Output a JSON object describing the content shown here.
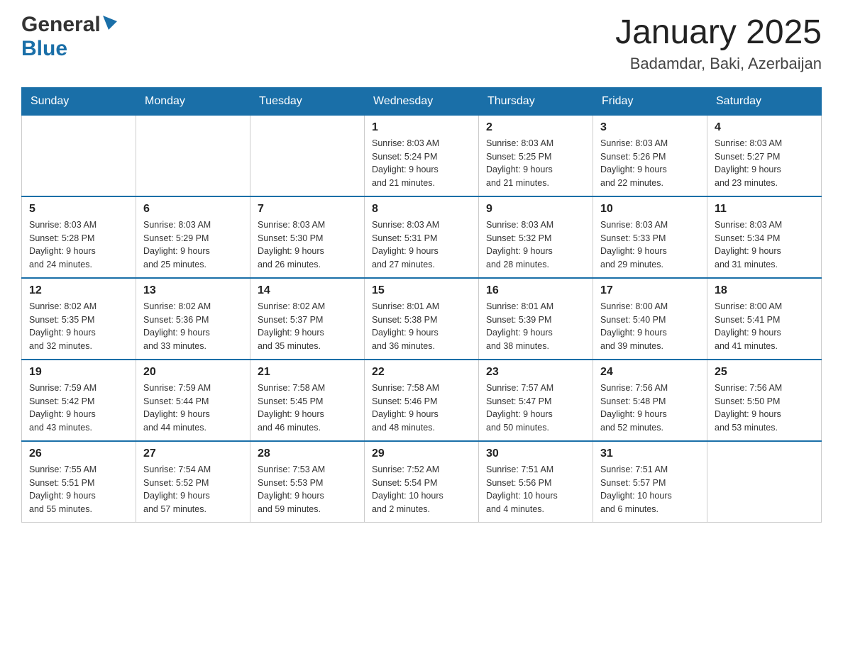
{
  "header": {
    "logo_general": "General",
    "logo_blue": "Blue",
    "month": "January 2025",
    "location": "Badamdar, Baki, Azerbaijan"
  },
  "days_of_week": [
    "Sunday",
    "Monday",
    "Tuesday",
    "Wednesday",
    "Thursday",
    "Friday",
    "Saturday"
  ],
  "weeks": [
    [
      {
        "day": "",
        "info": ""
      },
      {
        "day": "",
        "info": ""
      },
      {
        "day": "",
        "info": ""
      },
      {
        "day": "1",
        "info": "Sunrise: 8:03 AM\nSunset: 5:24 PM\nDaylight: 9 hours\nand 21 minutes."
      },
      {
        "day": "2",
        "info": "Sunrise: 8:03 AM\nSunset: 5:25 PM\nDaylight: 9 hours\nand 21 minutes."
      },
      {
        "day": "3",
        "info": "Sunrise: 8:03 AM\nSunset: 5:26 PM\nDaylight: 9 hours\nand 22 minutes."
      },
      {
        "day": "4",
        "info": "Sunrise: 8:03 AM\nSunset: 5:27 PM\nDaylight: 9 hours\nand 23 minutes."
      }
    ],
    [
      {
        "day": "5",
        "info": "Sunrise: 8:03 AM\nSunset: 5:28 PM\nDaylight: 9 hours\nand 24 minutes."
      },
      {
        "day": "6",
        "info": "Sunrise: 8:03 AM\nSunset: 5:29 PM\nDaylight: 9 hours\nand 25 minutes."
      },
      {
        "day": "7",
        "info": "Sunrise: 8:03 AM\nSunset: 5:30 PM\nDaylight: 9 hours\nand 26 minutes."
      },
      {
        "day": "8",
        "info": "Sunrise: 8:03 AM\nSunset: 5:31 PM\nDaylight: 9 hours\nand 27 minutes."
      },
      {
        "day": "9",
        "info": "Sunrise: 8:03 AM\nSunset: 5:32 PM\nDaylight: 9 hours\nand 28 minutes."
      },
      {
        "day": "10",
        "info": "Sunrise: 8:03 AM\nSunset: 5:33 PM\nDaylight: 9 hours\nand 29 minutes."
      },
      {
        "day": "11",
        "info": "Sunrise: 8:03 AM\nSunset: 5:34 PM\nDaylight: 9 hours\nand 31 minutes."
      }
    ],
    [
      {
        "day": "12",
        "info": "Sunrise: 8:02 AM\nSunset: 5:35 PM\nDaylight: 9 hours\nand 32 minutes."
      },
      {
        "day": "13",
        "info": "Sunrise: 8:02 AM\nSunset: 5:36 PM\nDaylight: 9 hours\nand 33 minutes."
      },
      {
        "day": "14",
        "info": "Sunrise: 8:02 AM\nSunset: 5:37 PM\nDaylight: 9 hours\nand 35 minutes."
      },
      {
        "day": "15",
        "info": "Sunrise: 8:01 AM\nSunset: 5:38 PM\nDaylight: 9 hours\nand 36 minutes."
      },
      {
        "day": "16",
        "info": "Sunrise: 8:01 AM\nSunset: 5:39 PM\nDaylight: 9 hours\nand 38 minutes."
      },
      {
        "day": "17",
        "info": "Sunrise: 8:00 AM\nSunset: 5:40 PM\nDaylight: 9 hours\nand 39 minutes."
      },
      {
        "day": "18",
        "info": "Sunrise: 8:00 AM\nSunset: 5:41 PM\nDaylight: 9 hours\nand 41 minutes."
      }
    ],
    [
      {
        "day": "19",
        "info": "Sunrise: 7:59 AM\nSunset: 5:42 PM\nDaylight: 9 hours\nand 43 minutes."
      },
      {
        "day": "20",
        "info": "Sunrise: 7:59 AM\nSunset: 5:44 PM\nDaylight: 9 hours\nand 44 minutes."
      },
      {
        "day": "21",
        "info": "Sunrise: 7:58 AM\nSunset: 5:45 PM\nDaylight: 9 hours\nand 46 minutes."
      },
      {
        "day": "22",
        "info": "Sunrise: 7:58 AM\nSunset: 5:46 PM\nDaylight: 9 hours\nand 48 minutes."
      },
      {
        "day": "23",
        "info": "Sunrise: 7:57 AM\nSunset: 5:47 PM\nDaylight: 9 hours\nand 50 minutes."
      },
      {
        "day": "24",
        "info": "Sunrise: 7:56 AM\nSunset: 5:48 PM\nDaylight: 9 hours\nand 52 minutes."
      },
      {
        "day": "25",
        "info": "Sunrise: 7:56 AM\nSunset: 5:50 PM\nDaylight: 9 hours\nand 53 minutes."
      }
    ],
    [
      {
        "day": "26",
        "info": "Sunrise: 7:55 AM\nSunset: 5:51 PM\nDaylight: 9 hours\nand 55 minutes."
      },
      {
        "day": "27",
        "info": "Sunrise: 7:54 AM\nSunset: 5:52 PM\nDaylight: 9 hours\nand 57 minutes."
      },
      {
        "day": "28",
        "info": "Sunrise: 7:53 AM\nSunset: 5:53 PM\nDaylight: 9 hours\nand 59 minutes."
      },
      {
        "day": "29",
        "info": "Sunrise: 7:52 AM\nSunset: 5:54 PM\nDaylight: 10 hours\nand 2 minutes."
      },
      {
        "day": "30",
        "info": "Sunrise: 7:51 AM\nSunset: 5:56 PM\nDaylight: 10 hours\nand 4 minutes."
      },
      {
        "day": "31",
        "info": "Sunrise: 7:51 AM\nSunset: 5:57 PM\nDaylight: 10 hours\nand 6 minutes."
      },
      {
        "day": "",
        "info": ""
      }
    ]
  ]
}
